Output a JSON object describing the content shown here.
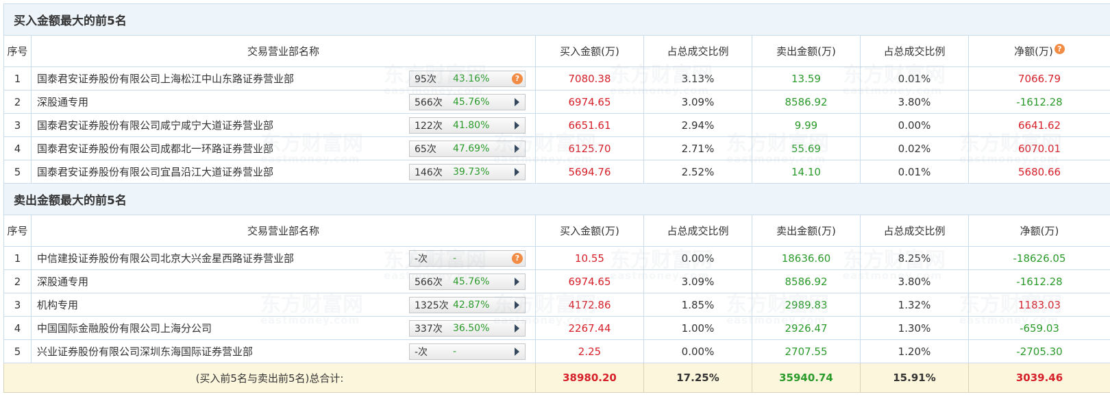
{
  "buy_section": {
    "title": "买入金额最大的前5名",
    "headers": [
      "序号",
      "交易营业部名称",
      "买入金额(万)",
      "占总成交比例",
      "卖出金额(万)",
      "占总成交比例",
      "净额(万)"
    ],
    "rows": [
      {
        "idx": "1",
        "name": "国泰君安证券股份有限公司上海松江中山东路证券营业部",
        "count": "95次",
        "pct": "43.16%",
        "buy": "7080.38",
        "buy_ratio": "3.13%",
        "sell": "13.59",
        "sell_ratio": "0.01%",
        "net": "7066.79"
      },
      {
        "idx": "2",
        "name": "深股通专用",
        "count": "566次",
        "pct": "45.76%",
        "buy": "6974.65",
        "buy_ratio": "3.09%",
        "sell": "8586.92",
        "sell_ratio": "3.80%",
        "net": "-1612.28"
      },
      {
        "idx": "3",
        "name": "国泰君安证券股份有限公司咸宁咸宁大道证券营业部",
        "count": "122次",
        "pct": "41.80%",
        "buy": "6651.61",
        "buy_ratio": "2.94%",
        "sell": "9.99",
        "sell_ratio": "0.00%",
        "net": "6641.62"
      },
      {
        "idx": "4",
        "name": "国泰君安证券股份有限公司成都北一环路证券营业部",
        "count": "65次",
        "pct": "47.69%",
        "buy": "6125.70",
        "buy_ratio": "2.71%",
        "sell": "55.69",
        "sell_ratio": "0.02%",
        "net": "6070.01"
      },
      {
        "idx": "5",
        "name": "国泰君安证券股份有限公司宜昌沿江大道证券营业部",
        "count": "146次",
        "pct": "39.73%",
        "buy": "5694.76",
        "buy_ratio": "2.52%",
        "sell": "14.10",
        "sell_ratio": "0.01%",
        "net": "5680.66"
      }
    ]
  },
  "sell_section": {
    "title": "卖出金额最大的前5名",
    "headers": [
      "序号",
      "交易营业部名称",
      "买入金额(万)",
      "占总成交比例",
      "卖出金额(万)",
      "占总成交比例",
      "净额(万)"
    ],
    "rows": [
      {
        "idx": "1",
        "name": "中信建投证券股份有限公司北京大兴金星西路证券营业部",
        "count": "-次",
        "pct": "-",
        "buy": "10.55",
        "buy_ratio": "0.00%",
        "sell": "18636.60",
        "sell_ratio": "8.25%",
        "net": "-18626.05"
      },
      {
        "idx": "2",
        "name": "深股通专用",
        "count": "566次",
        "pct": "45.76%",
        "buy": "6974.65",
        "buy_ratio": "3.09%",
        "sell": "8586.92",
        "sell_ratio": "3.80%",
        "net": "-1612.28"
      },
      {
        "idx": "3",
        "name": "机构专用",
        "count": "1325次",
        "pct": "42.87%",
        "buy": "4172.86",
        "buy_ratio": "1.85%",
        "sell": "2989.83",
        "sell_ratio": "1.32%",
        "net": "1183.03"
      },
      {
        "idx": "4",
        "name": "中国国际金融股份有限公司上海分公司",
        "count": "337次",
        "pct": "36.50%",
        "buy": "2267.44",
        "buy_ratio": "1.00%",
        "sell": "2926.47",
        "sell_ratio": "1.30%",
        "net": "-659.03"
      },
      {
        "idx": "5",
        "name": "兴业证券股份有限公司深圳东海国际证券营业部",
        "count": "-次",
        "pct": "-",
        "buy": "2.25",
        "buy_ratio": "0.00%",
        "sell": "2707.55",
        "sell_ratio": "1.20%",
        "net": "-2705.30"
      }
    ]
  },
  "total": {
    "label": "(买入前5名与卖出前5名)总合计:",
    "buy": "38980.20",
    "buy_ratio": "17.25%",
    "sell": "35940.74",
    "sell_ratio": "15.91%",
    "net": "3039.46"
  },
  "help_glyph": "?",
  "watermark": {
    "cn": "东方财富网",
    "en": "eastmoney.com"
  },
  "colors": {
    "red": "#d6202a",
    "green": "#2a9a2a",
    "header_bg": "#edf4fa",
    "total_bg": "#fcf6dc",
    "border": "#c9dced",
    "help": "#f28c44"
  }
}
